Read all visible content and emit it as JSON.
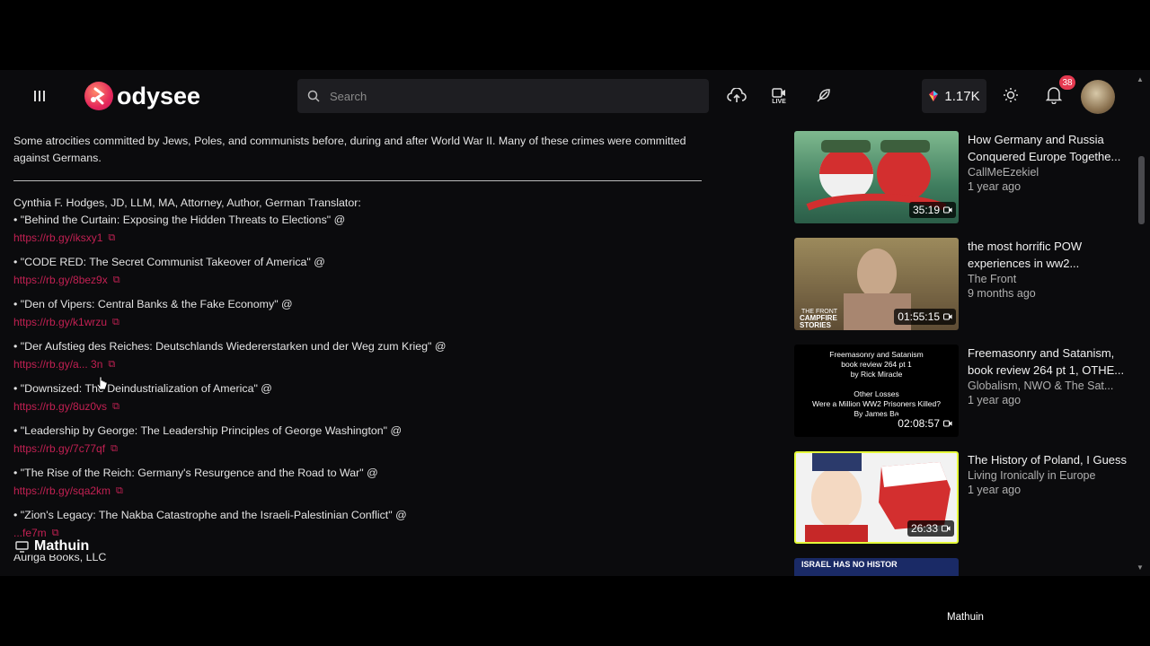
{
  "header": {
    "logo_text": "odysee",
    "search_placeholder": "Search",
    "live_label": "LIVE",
    "wallet_balance": "1.17K",
    "notification_count": "38"
  },
  "description": {
    "intro": "Some atrocities committed by Jews, Poles, and communists before, during and after World War II. Many of these crimes were committed against Germans.",
    "author_line": "Cynthia F. Hodges, JD, LLM, MA, Attorney, Author, German Translator:",
    "books": [
      {
        "title": "• \"Behind the Curtain: Exposing the Hidden Threats to Elections\" @",
        "link": "https://rb.gy/iksxy1"
      },
      {
        "title": "• \"CODE RED: The Secret Communist Takeover of America\" @",
        "link": "https://rb.gy/8bez9x"
      },
      {
        "title": "• \"Den of Vipers: Central Banks & the Fake Economy\" @",
        "link": "https://rb.gy/k1wrzu"
      },
      {
        "title": "• \"Der Aufstieg des Reiches: Deutschlands Wiedererstarken und der Weg zum Krieg\" @",
        "link": "https://rb.gy/a... 3n"
      },
      {
        "title": "• \"Downsized: The Deindustrialization of America\" @",
        "link": "https://rb.gy/8uz0vs"
      },
      {
        "title": "• \"Leadership by George: The Leadership Principles of George Washington\" @",
        "link": "https://rb.gy/7c77qf"
      },
      {
        "title": "• \"The Rise of the Reich: Germany's Resurgence and the Road to War\" @",
        "link": "https://rb.gy/sqa2km"
      },
      {
        "title": "• \"Zion's Legacy: The Nakba Catastrophe and the Israeli-Palestinian Conflict\" @",
        "link": "...fe7m"
      }
    ],
    "publisher": "Auriga Books, LLC",
    "overlay_channel": "Mathuin"
  },
  "related": [
    {
      "title": "How Germany and Russia Conquered Europe Togethe...",
      "channel": "CallMeEzekiel",
      "age": "1 year ago",
      "duration": "35:19",
      "thumb_bg": "#2f6b4f"
    },
    {
      "title": "the most horrific POW experiences in ww2...",
      "channel": "The Front",
      "age": "9 months ago",
      "duration": "01:55:15",
      "thumb_bg": "#6d5a3c",
      "thumb_text": "THE FRONT CAMPFIRE STORIES"
    },
    {
      "title": "Freemasonry and Satanism, book review 264 pt 1, OTHE...",
      "channel": "Globalism, NWO & The Sat...",
      "age": "1 year ago",
      "duration": "02:08:57",
      "thumb_bg": "#000000",
      "thumb_lines": [
        "Freemasonry and Satanism",
        "book review 264 pt 1",
        "by Rick Miracle",
        "Other Losses",
        "Were a Million WW2 Prisoners Killed?",
        "By James Ba"
      ]
    },
    {
      "title": "The History of Poland, I Guess",
      "channel": "Living Ironically in Europe",
      "age": "1 year ago",
      "duration": "26:33",
      "thumb_bg": "#f2f2f2"
    },
    {
      "title": "",
      "channel": "",
      "age": "",
      "duration": "",
      "thumb_bg": "#1a2a66",
      "thumb_text": "ISRAEL HAS NO HISTOR"
    }
  ],
  "bottom_caption": "Mathuin",
  "colors": {
    "link": "#e2245f",
    "badge": "#e53950",
    "header_bg": "#0b0b0d"
  }
}
